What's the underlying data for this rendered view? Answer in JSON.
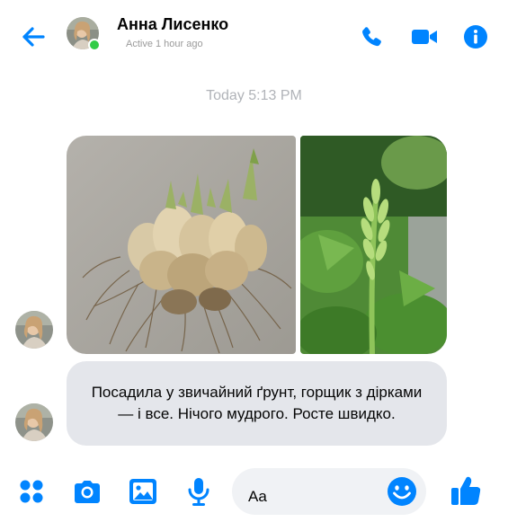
{
  "header": {
    "contact_name": "Анна Лисенко",
    "status": "Active 1 hour ago",
    "accent_color": "#0084ff",
    "online_color": "#31cc46",
    "icons": [
      "back-arrow-icon",
      "phone-icon",
      "video-camera-icon",
      "info-icon"
    ]
  },
  "conversation": {
    "timestamp": "Today 5:13 PM",
    "attachments": [
      {
        "kind": "photo",
        "subject": "bulb-cluster-with-roots"
      },
      {
        "kind": "photo",
        "subject": "green-flower-stalk"
      }
    ],
    "message": "Посадила у звичайний ґрунт, горщик з дірками — і все. Нічого мудрого. Росте швидко."
  },
  "composer": {
    "placeholder": "Aa",
    "icons": [
      "menu-dots-icon",
      "camera-icon",
      "gallery-icon",
      "microphone-icon",
      "emoji-icon",
      "thumbs-up-icon"
    ]
  }
}
